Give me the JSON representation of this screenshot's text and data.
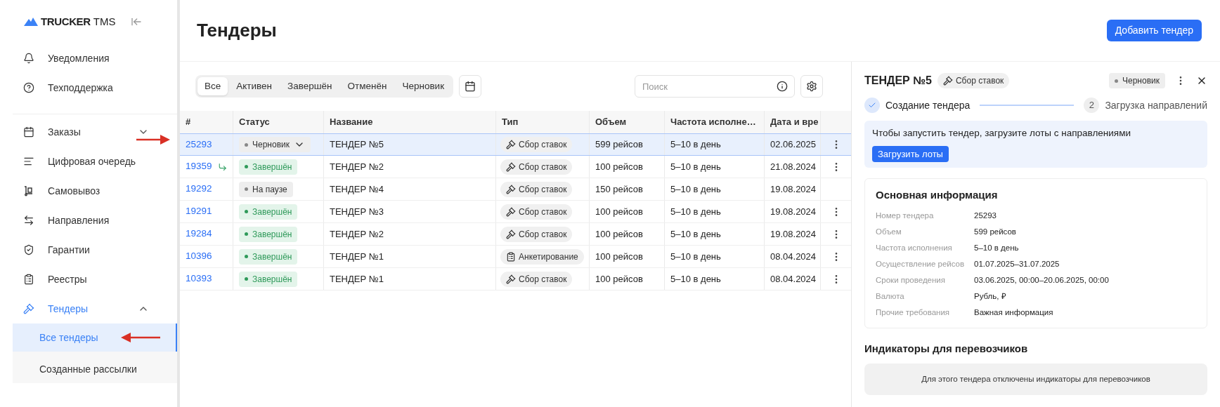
{
  "sidebar": {
    "logo": {
      "brand": "TRUCKER",
      "product": "TMS"
    },
    "top_items": [
      {
        "kind": "bell",
        "label": "Уведомления"
      },
      {
        "kind": "help",
        "label": "Техподдержка"
      }
    ],
    "items": [
      {
        "kind": "calendar",
        "label": "Заказы",
        "expanded": false,
        "selected": false
      },
      {
        "kind": "lines",
        "label": "Цифровая очередь",
        "selected": false
      },
      {
        "kind": "cart",
        "label": "Самовывоз",
        "selected": false
      },
      {
        "kind": "arrows",
        "label": "Направления",
        "selected": false
      },
      {
        "kind": "shield",
        "label": "Гарантии",
        "selected": false
      },
      {
        "kind": "clipboard",
        "label": "Реестры",
        "selected": false
      },
      {
        "kind": "gavel",
        "label": "Тендеры",
        "expanded": true,
        "selected": true,
        "children": [
          {
            "label": "Все тендеры",
            "selected": true
          },
          {
            "label": "Созданные рассылки",
            "selected": false
          }
        ]
      }
    ]
  },
  "page": {
    "title": "Тендеры",
    "add_button": "Добавить тендер"
  },
  "filters": [
    {
      "label": "Все",
      "selected": true
    },
    {
      "label": "Активен",
      "selected": false
    },
    {
      "label": "Завершён",
      "selected": false
    },
    {
      "label": "Отменён",
      "selected": false
    },
    {
      "label": "Черновик",
      "selected": false
    }
  ],
  "search": {
    "placeholder": "Поиск"
  },
  "table": {
    "columns": [
      "#",
      "Статус",
      "Название",
      "Тип",
      "Объем",
      "Частота исполне…",
      "Дата и вре"
    ],
    "rows": [
      {
        "id": "25293",
        "linked": false,
        "status": {
          "kind": "draft",
          "label": "Черновик"
        },
        "name": "ТЕНДЕР №5",
        "type": {
          "kind": "bids",
          "label": "Сбор ставок"
        },
        "volume": "599 рейсов",
        "frequency": "5–10 в день",
        "date": "02.06.2025",
        "has_menu": true,
        "selected": true
      },
      {
        "id": "19359",
        "linked": true,
        "status": {
          "kind": "done",
          "label": "Завершён"
        },
        "name": "ТЕНДЕР №2",
        "type": {
          "kind": "bids",
          "label": "Сбор ставок"
        },
        "volume": "100 рейсов",
        "frequency": "5–10 в день",
        "date": "21.08.2024",
        "has_menu": true,
        "selected": false
      },
      {
        "id": "19292",
        "linked": false,
        "status": {
          "kind": "paused",
          "label": "На паузе"
        },
        "name": "ТЕНДЕР №4",
        "type": {
          "kind": "bids",
          "label": "Сбор ставок"
        },
        "volume": "150 рейсов",
        "frequency": "5–10 в день",
        "date": "19.08.2024",
        "has_menu": false,
        "selected": false
      },
      {
        "id": "19291",
        "linked": false,
        "status": {
          "kind": "done",
          "label": "Завершён"
        },
        "name": "ТЕНДЕР №3",
        "type": {
          "kind": "bids",
          "label": "Сбор ставок"
        },
        "volume": "100 рейсов",
        "frequency": "5–10 в день",
        "date": "19.08.2024",
        "has_menu": true,
        "selected": false
      },
      {
        "id": "19284",
        "linked": false,
        "status": {
          "kind": "done",
          "label": "Завершён"
        },
        "name": "ТЕНДЕР №2",
        "type": {
          "kind": "bids",
          "label": "Сбор ставок"
        },
        "volume": "100 рейсов",
        "frequency": "5–10 в день",
        "date": "19.08.2024",
        "has_menu": true,
        "selected": false
      },
      {
        "id": "10396",
        "linked": false,
        "status": {
          "kind": "done",
          "label": "Завершён"
        },
        "name": "ТЕНДЕР №1",
        "type": {
          "kind": "survey",
          "label": "Анкетирование"
        },
        "volume": "100 рейсов",
        "frequency": "5–10 в день",
        "date": "08.04.2024",
        "has_menu": true,
        "selected": false
      },
      {
        "id": "10393",
        "linked": false,
        "status": {
          "kind": "done",
          "label": "Завершён"
        },
        "name": "ТЕНДЕР №1",
        "type": {
          "kind": "bids",
          "label": "Сбор ставок"
        },
        "volume": "100 рейсов",
        "frequency": "5–10 в день",
        "date": "08.04.2024",
        "has_menu": true,
        "selected": false
      }
    ]
  },
  "panel": {
    "title": "ТЕНДЕР №5",
    "type": {
      "kind": "bids",
      "label": "Сбор ставок"
    },
    "status": {
      "kind": "draft",
      "label": "Черновик"
    },
    "steps": [
      {
        "label": "Создание тендера",
        "done": true
      },
      {
        "number": "2",
        "label": "Загрузка направлений",
        "done": false
      }
    ],
    "notice": {
      "text": "Чтобы запустить тендер, загрузите лоты с направлениями",
      "button": "Загрузить лоты"
    },
    "info": {
      "title": "Основная информация",
      "fields": [
        {
          "label": "Номер тендера",
          "value": "25293"
        },
        {
          "label": "Объем",
          "value": "599 рейсов"
        },
        {
          "label": "Частота исполнения",
          "value": "5–10 в день"
        },
        {
          "label": "Осуществление рейсов",
          "value": "01.07.2025–31.07.2025"
        },
        {
          "label": "Сроки проведения",
          "value": "03.06.2025, 00:00–20.06.2025, 00:00"
        },
        {
          "label": "Валюта",
          "value": "Рубль, ₽"
        },
        {
          "label": "Прочие требования",
          "value": "Важная информация"
        }
      ]
    },
    "indicators": {
      "title": "Индикаторы для перевозчиков",
      "message": "Для этого тендера отключены индикаторы для перевозчиков"
    }
  }
}
